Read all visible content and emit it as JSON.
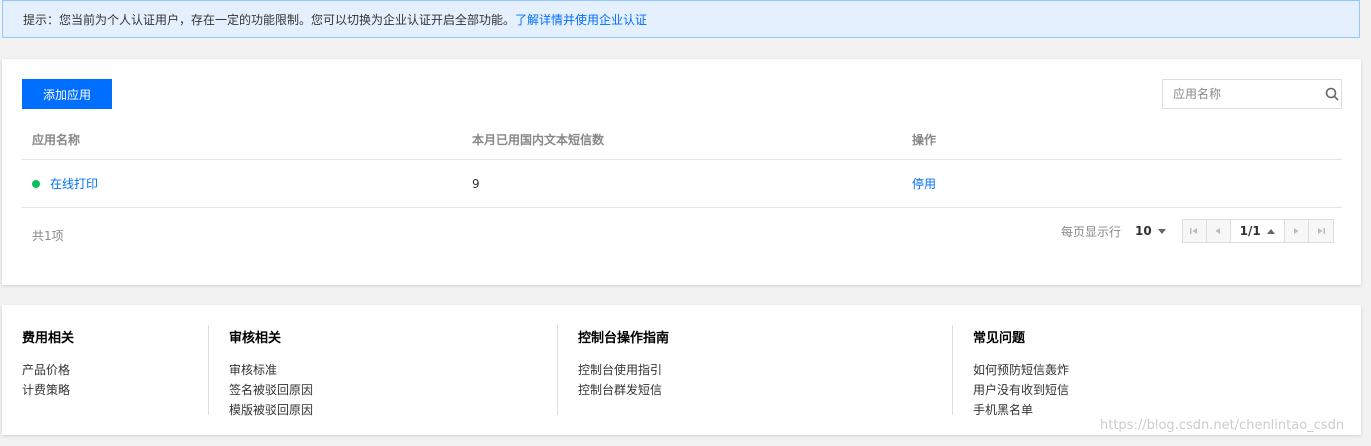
{
  "notice": {
    "text": "提示：您当前为个人认证用户，存在一定的功能限制。您可以切换为企业认证开启全部功能。",
    "link": "了解详情并使用企业认证"
  },
  "toolbar": {
    "add_label": "添加应用",
    "search_placeholder": "应用名称",
    "search_icon": "search-icon"
  },
  "table": {
    "columns": [
      "应用名称",
      "本月已用国内文本短信数",
      "操作"
    ],
    "rows": [
      {
        "name": "在线打印",
        "count": "9",
        "action": "停用",
        "status_color": "#0abf5b"
      }
    ]
  },
  "pagination": {
    "total": "共1项",
    "per_page_label": "每页显示行",
    "per_page": "10",
    "page": "1/1"
  },
  "footer": {
    "columns": [
      {
        "title": "费用相关",
        "items": [
          "产品价格",
          "计费策略"
        ]
      },
      {
        "title": "审核相关",
        "items": [
          "审核标准",
          "签名被驳回原因",
          "模版被驳回原因"
        ]
      },
      {
        "title": "控制台操作指南",
        "items": [
          "控制台使用指引",
          "控制台群发短信"
        ]
      },
      {
        "title": "常见问题",
        "items": [
          "如何预防短信轰炸",
          "用户没有收到短信",
          "手机黑名单"
        ]
      }
    ]
  },
  "watermark": "https://blog.csdn.net/chenlintao_csdn",
  "colors": {
    "accent": "#006eff",
    "notice_bg": "#e5f0ff",
    "status_ok": "#0abf5b"
  }
}
